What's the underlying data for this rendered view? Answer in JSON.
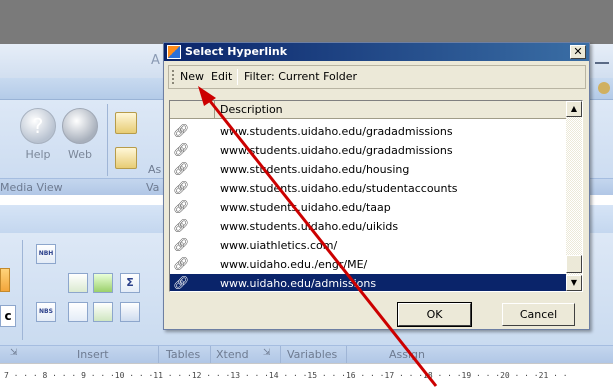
{
  "background_app": {
    "ribbon_letter": "A",
    "buttons": {
      "help": "Help",
      "web": "Web",
      "as_fragment": "As"
    },
    "group_labels": {
      "media_view": "Media View",
      "va_fragment": "Va",
      "insert": "Insert",
      "tables": "Tables",
      "xtend": "Xtend",
      "variables": "Variables",
      "assign": "Assign"
    },
    "tool_labels": {
      "nbh": "NBH",
      "nbs": "NBS",
      "sigma": "Σ",
      "c": "c"
    },
    "ruler_text": "7 · · · 8 · · · 9 · · ·10 · · ·11 · · ·12 · · ·13 · · ·14 · · ·15 · · ·16 · · ·17 · · ·18 · · ·19 · · ·20 · · ·21 · ·"
  },
  "dialog": {
    "title": "Select Hyperlink",
    "close_glyph": "✕",
    "toolbar": {
      "new": "New",
      "edit": "Edit",
      "filter": "Filter:  Current Folder"
    },
    "column_header": "Description",
    "rows": [
      "www.students.uidaho.edu/gradadmissions",
      "www.students.uidaho.edu/gradadmissions",
      "www.students.uidaho.edu/housing",
      "www.students.uidaho.edu/studentaccounts",
      "www.students.uidaho.edu/taap",
      "www.students.uidaho.edu/uikids",
      "www.uiathletics.com/",
      "www.uidaho.edu./engr/ME/",
      "www.uidaho.edu/admissions"
    ],
    "selected_row": "www.uidaho.edu/admissions",
    "ok_label": "OK",
    "cancel_label": "Cancel"
  },
  "colors": {
    "title_bar": "#0a246a",
    "selection": "#0a246a",
    "arrow": "#cc0000"
  }
}
